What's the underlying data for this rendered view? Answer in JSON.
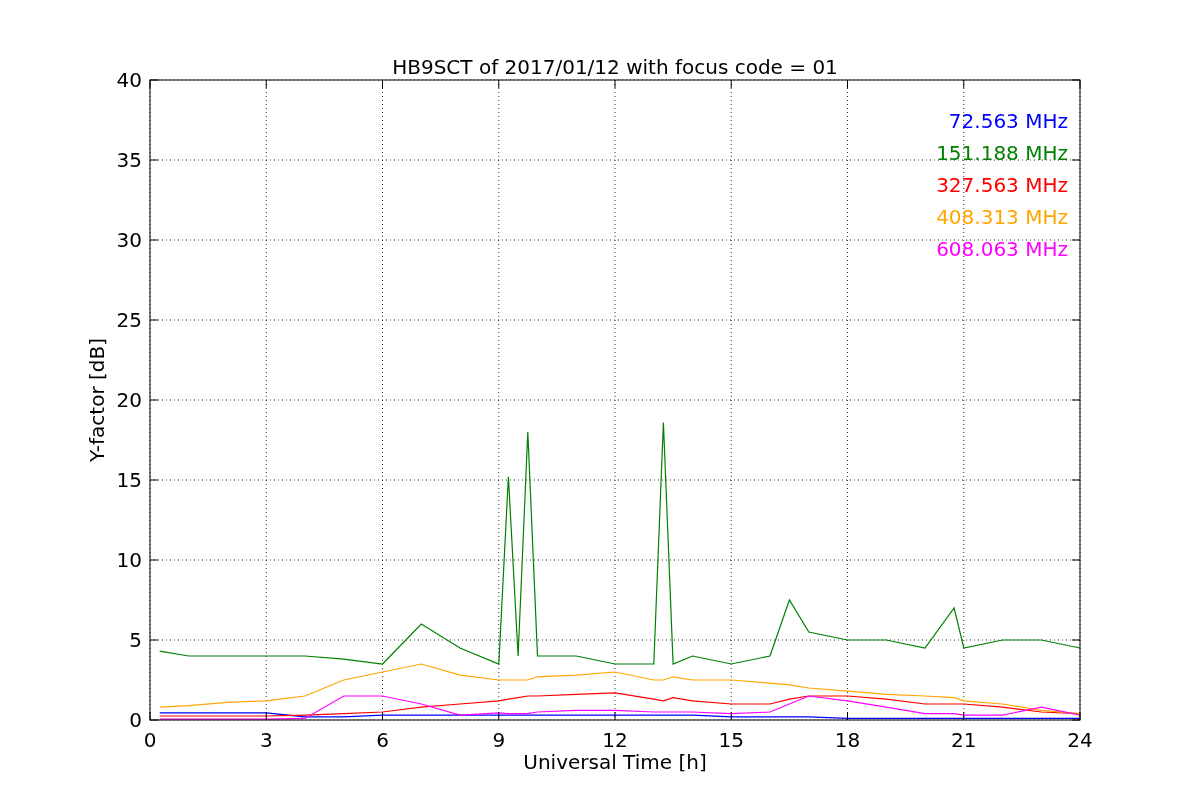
{
  "figure": {
    "chart_data": {
      "type": "line",
      "title": "HB9SCT of 2017/01/12 with focus code = 01",
      "xlabel": "Universal Time [h]",
      "ylabel": "Y-factor [dB]",
      "x": [
        0.25,
        1,
        2,
        3,
        4,
        5,
        6,
        7,
        8,
        9,
        9.25,
        9.5,
        9.75,
        10,
        11,
        12,
        13,
        13.25,
        13.5,
        14,
        15,
        16,
        16.5,
        17,
        18,
        19,
        20,
        20.75,
        21,
        22,
        23,
        24
      ],
      "series": [
        {
          "name": "72.563 MHz",
          "color": "#0000ff",
          "values": [
            0.45,
            0.45,
            0.45,
            0.45,
            0.2,
            0.2,
            0.3,
            0.3,
            0.3,
            0.3,
            0.3,
            0.3,
            0.3,
            0.3,
            0.3,
            0.3,
            0.3,
            0.3,
            0.3,
            0.3,
            0.2,
            0.2,
            0.2,
            0.2,
            0.1,
            0.1,
            0.1,
            0.1,
            0.1,
            0.1,
            0.1,
            0.1
          ]
        },
        {
          "name": "151.188 MHz",
          "color": "#008000",
          "values": [
            4.3,
            4,
            4,
            4,
            4,
            3.8,
            3.5,
            6,
            4.5,
            3.5,
            15.2,
            4,
            18,
            4,
            4,
            3.5,
            3.5,
            18.6,
            3.5,
            4,
            3.5,
            4,
            7.5,
            5.5,
            5,
            5,
            4.5,
            7,
            4.5,
            5,
            5,
            4.5
          ]
        },
        {
          "name": "327.563 MHz",
          "color": "#ff0000",
          "values": [
            0.25,
            0.25,
            0.25,
            0.25,
            0.3,
            0.4,
            0.5,
            0.8,
            1,
            1.2,
            1.3,
            1.4,
            1.5,
            1.5,
            1.6,
            1.7,
            1.3,
            1.2,
            1.4,
            1.2,
            1,
            1,
            1.3,
            1.5,
            1.5,
            1.3,
            1,
            1,
            1,
            0.8,
            0.5,
            0.4
          ]
        },
        {
          "name": "408.313 MHz",
          "color": "#ffa500",
          "values": [
            0.8,
            0.9,
            1.1,
            1.2,
            1.5,
            2.5,
            3,
            3.5,
            2.8,
            2.5,
            2.5,
            2.5,
            2.5,
            2.7,
            2.8,
            3,
            2.5,
            2.5,
            2.7,
            2.5,
            2.5,
            2.3,
            2.2,
            2,
            1.8,
            1.6,
            1.5,
            1.4,
            1.2,
            1,
            0.6,
            0.4
          ]
        },
        {
          "name": "608.063 MHz",
          "color": "#ff00ff",
          "values": [
            0.05,
            0.05,
            0.05,
            0.05,
            0.1,
            1.5,
            1.5,
            1,
            0.3,
            0.45,
            0.4,
            0.4,
            0.4,
            0.5,
            0.6,
            0.6,
            0.5,
            0.5,
            0.5,
            0.5,
            0.4,
            0.5,
            1,
            1.5,
            1.2,
            0.8,
            0.4,
            0.4,
            0.3,
            0.3,
            0.8,
            0.3
          ]
        }
      ],
      "grid": true,
      "xlim": [
        0,
        24
      ],
      "ylim": [
        0,
        40
      ],
      "xticks": [
        0,
        3,
        6,
        9,
        12,
        15,
        18,
        21,
        24
      ],
      "yticks": [
        0,
        5,
        10,
        15,
        20,
        25,
        30,
        35,
        40
      ]
    }
  }
}
